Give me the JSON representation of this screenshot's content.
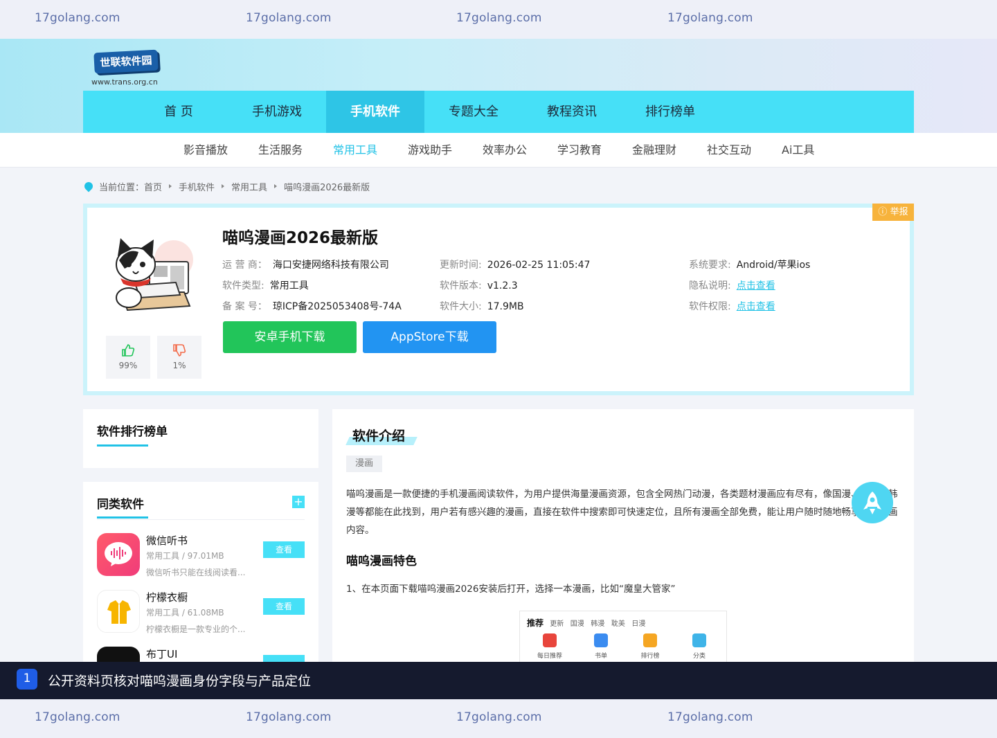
{
  "watermark": {
    "text": "17golang.com"
  },
  "site": {
    "logo_title": "世联软件园",
    "logo_url": "www.trans.org.cn"
  },
  "main_nav": [
    {
      "label": "首 页"
    },
    {
      "label": "手机游戏"
    },
    {
      "label": "手机软件"
    },
    {
      "label": "专题大全"
    },
    {
      "label": "教程资讯"
    },
    {
      "label": "排行榜单"
    }
  ],
  "sub_nav": [
    {
      "label": "影音播放"
    },
    {
      "label": "生活服务"
    },
    {
      "label": "常用工具"
    },
    {
      "label": "游戏助手"
    },
    {
      "label": "效率办公"
    },
    {
      "label": "学习教育"
    },
    {
      "label": "金融理财"
    },
    {
      "label": "社交互动"
    },
    {
      "label": "Ai工具"
    }
  ],
  "breadcrumb": {
    "prefix": "当前位置：",
    "items": [
      "首页",
      "手机软件",
      "常用工具",
      "喵呜漫画2026最新版"
    ]
  },
  "app": {
    "report_label": "举报",
    "title": "喵呜漫画2026最新版",
    "likes": "99%",
    "dislikes": "1%",
    "meta": {
      "operator_label": "运 营 商：",
      "operator": "海口安捷网络科技有限公司",
      "type_label": "软件类型:",
      "type": "常用工具",
      "icp_label": "备 案 号：",
      "icp": "琼ICP备2025053408号-74A",
      "update_label": "更新时间:",
      "update": "2026-02-25 11:05:47",
      "version_label": "软件版本:",
      "version": "v1.2.3",
      "size_label": "软件大小:",
      "size": "17.9MB",
      "system_label": "系统要求:",
      "system": "Android/苹果ios",
      "privacy_label": "隐私说明:",
      "privacy": "点击查看",
      "permission_label": "软件权限:",
      "permission": "点击查看"
    },
    "android_button": "安卓手机下载",
    "appstore_button": "AppStore下载"
  },
  "ranking": {
    "title": "软件排行榜单"
  },
  "similar": {
    "title": "同类软件",
    "plus": "+",
    "items": [
      {
        "name": "微信听书",
        "meta": "常用工具 / 97.01MB",
        "desc": "微信听书只能在线阅读看...",
        "button": "查看"
      },
      {
        "name": "柠檬衣橱",
        "meta": "常用工具 / 61.08MB",
        "desc": "柠檬衣橱是一款专业的个...",
        "button": "查看"
      },
      {
        "name": "布丁UI",
        "meta": "",
        "desc": "",
        "button": ""
      }
    ]
  },
  "intro": {
    "title": "软件介绍",
    "tag": "漫画",
    "paragraph": "喵呜漫画是一款便捷的手机漫画阅读软件，为用户提供海量漫画资源，包含全网热门动漫，各类题材漫画应有尽有，像国漫、日漫、韩漫等都能在此找到，用户若有感兴趣的漫画，直接在软件中搜索即可快速定位，且所有漫画全部免费，能让用户随时随地畅享海量漫画内容。",
    "feature_title": "喵呜漫画特色",
    "step1": "1、在本页面下载喵呜漫画2026安装后打开，选择一本漫画，比如“魔皇大管家”",
    "screenshot": {
      "tab_active": "推荐",
      "tabs": [
        "更新",
        "国漫",
        "韩漫",
        "耽美",
        "日漫"
      ],
      "cells": [
        "每日推荐",
        "书单",
        "排行榜",
        "分类"
      ]
    }
  },
  "caption": {
    "number": "1",
    "text": "公开资料页核对喵呜漫画身份字段与产品定位"
  }
}
